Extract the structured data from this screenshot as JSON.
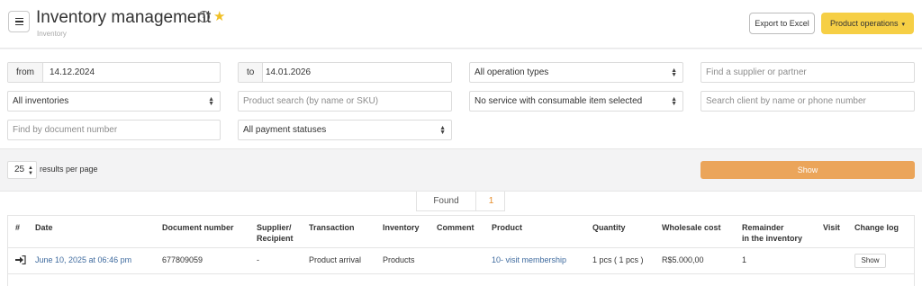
{
  "header": {
    "title": "Inventory management",
    "breadcrumb": "Inventory",
    "info_icon": "i",
    "star_icon": "★",
    "export_label": "Export to Excel",
    "operations_label": "Product operations",
    "operations_caret": "▾"
  },
  "filters": {
    "from_label": "from",
    "from_value": "14.12.2024",
    "to_label": "to",
    "to_value": "14.01.2026",
    "operation_type": "All operation types",
    "supplier_placeholder": "Find a supplier or partner",
    "inventories": "All inventories",
    "product_placeholder": "Product search (by name or SKU)",
    "service": "No service with consumable item selected",
    "client_placeholder": "Search client by name or phone number",
    "document_placeholder": "Find by document number",
    "payment_status": "All payment statuses"
  },
  "pagination": {
    "per_page": "25",
    "per_page_label": "results per page",
    "show_label": "Show"
  },
  "results": {
    "found_label": "Found",
    "found_count": "1"
  },
  "table": {
    "headers": {
      "num": "#",
      "date": "Date",
      "document": "Document number",
      "supplier_line1": "Supplier/",
      "supplier_line2": "Recipient",
      "transaction": "Transaction",
      "inventory": "Inventory",
      "comment": "Comment",
      "product": "Product",
      "quantity": "Quantity",
      "wholesale": "Wholesale cost",
      "remainder_line1": "Remainder",
      "remainder_line2": "in the inventory",
      "visit": "Visit",
      "changelog": "Change log"
    },
    "rows": [
      {
        "date": "June 10, 2025 at 06:46 pm",
        "document": "677809059",
        "supplier": "-",
        "transaction": "Product arrival",
        "inventory": "Products",
        "comment": "",
        "product": "10- visit membership",
        "quantity": "1 pcs ( 1 pcs )",
        "wholesale": "R$5.000,00",
        "remainder": "1",
        "visit": "",
        "changelog_label": "Show"
      }
    ]
  },
  "icons": {
    "menu": "hamburger-icon",
    "arrival": "sign-in-icon"
  },
  "colors": {
    "accent_yellow": "#f6cf45",
    "show_orange": "#eba55a",
    "link_blue": "#3e6a9e",
    "found_count": "#e68d2c"
  }
}
